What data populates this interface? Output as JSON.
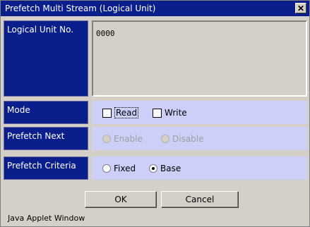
{
  "window": {
    "title": "Prefetch Multi Stream (Logical Unit)",
    "close_glyph": "✕"
  },
  "logical_unit": {
    "label": "Logical Unit No.",
    "value": "0000"
  },
  "mode": {
    "label": "Mode",
    "read": {
      "label": "Read",
      "checked": false
    },
    "write": {
      "label": "Write",
      "checked": false
    }
  },
  "prefetch_next": {
    "label": "Prefetch Next",
    "enable": {
      "label": "Enable",
      "selected": false,
      "disabled": true
    },
    "disable": {
      "label": "Disable",
      "selected": false,
      "disabled": true
    }
  },
  "prefetch_criteria": {
    "label": "Prefetch Criteria",
    "fixed": {
      "label": "Fixed",
      "selected": false
    },
    "base": {
      "label": "Base",
      "selected": true
    }
  },
  "buttons": {
    "ok": "OK",
    "cancel": "Cancel"
  },
  "status_bar": {
    "text": "Java Applet Window"
  },
  "colors": {
    "label_bg": "#0a1e8c",
    "field_bg": "#ccd0f8",
    "window_bg": "#d4d0c8"
  }
}
